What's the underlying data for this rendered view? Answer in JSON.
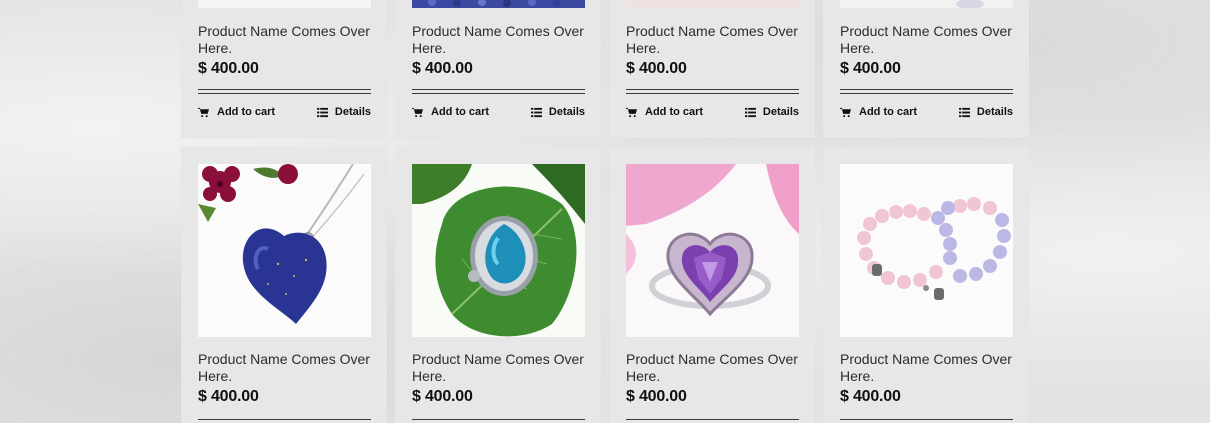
{
  "products_row1": [
    {
      "name": "Product Name Comes Over Here.",
      "price": "$ 400.00",
      "add_to_cart": "Add to cart",
      "details": "Details"
    },
    {
      "name": "Product Name Comes Over Here.",
      "price": "$ 400.00",
      "add_to_cart": "Add to cart",
      "details": "Details"
    },
    {
      "name": "Product Name Comes Over Here.",
      "price": "$ 400.00",
      "add_to_cart": "Add to cart",
      "details": "Details"
    },
    {
      "name": "Product Name Comes Over Here.",
      "price": "$ 400.00",
      "add_to_cart": "Add to cart",
      "details": "Details"
    }
  ],
  "products_row2": [
    {
      "name": "Product Name Comes Over Here.",
      "price": "$ 400.00",
      "image": "lapis-heart-pendant"
    },
    {
      "name": "Product Name Comes Over Here.",
      "price": "$ 400.00",
      "image": "turquoise-ring-on-leaf"
    },
    {
      "name": "Product Name Comes Over Here.",
      "price": "$ 400.00",
      "image": "amethyst-heart-ring"
    },
    {
      "name": "Product Name Comes Over Here.",
      "price": "$ 400.00",
      "image": "pastel-bead-bracelets"
    }
  ],
  "icons": {
    "cart": "shopping-cart-icon",
    "details": "list-icon"
  },
  "colors": {
    "card_bg": "#e7e7e7",
    "page_bg": "#e3e3e3",
    "text": "#111111"
  }
}
